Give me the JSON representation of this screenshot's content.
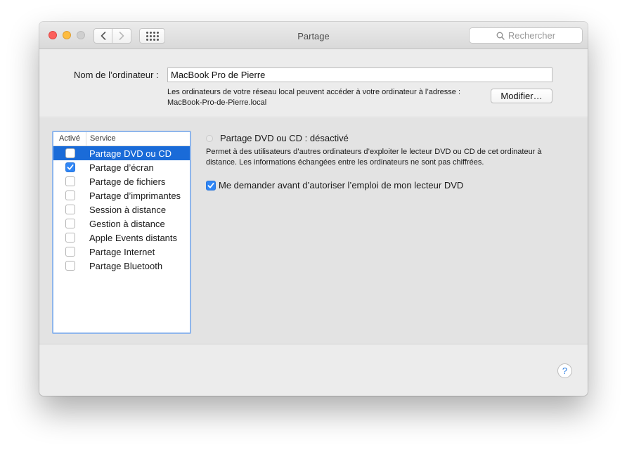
{
  "window": {
    "title": "Partage",
    "search_placeholder": "Rechercher"
  },
  "computer_name": {
    "label": "Nom de l’ordinateur :",
    "value": "MacBook Pro de Pierre",
    "note_line1": "Les ordinateurs de votre réseau local peuvent accéder à votre ordinateur à l’adresse :",
    "note_line2": "MacBook-Pro-de-Pierre.local",
    "modify_button": "Modifier…"
  },
  "services": {
    "header_active": "Activé",
    "header_service": "Service",
    "items": [
      {
        "label": "Partage DVD ou CD",
        "checked": false,
        "selected": true
      },
      {
        "label": "Partage d’écran",
        "checked": true,
        "selected": false
      },
      {
        "label": "Partage de fichiers",
        "checked": false,
        "selected": false
      },
      {
        "label": "Partage d’imprimantes",
        "checked": false,
        "selected": false
      },
      {
        "label": "Session à distance",
        "checked": false,
        "selected": false
      },
      {
        "label": "Gestion à distance",
        "checked": false,
        "selected": false
      },
      {
        "label": "Apple Events distants",
        "checked": false,
        "selected": false
      },
      {
        "label": "Partage Internet",
        "checked": false,
        "selected": false
      },
      {
        "label": "Partage Bluetooth",
        "checked": false,
        "selected": false
      }
    ]
  },
  "detail": {
    "status_title": "Partage DVD ou CD : désactivé",
    "description_line1": "Permet à des utilisateurs d’autres ordinateurs d’exploiter le lecteur DVD ou CD de cet ordinateur à",
    "description_line2": "distance. Les informations échangées entre les ordinateurs ne sont pas chiffrées.",
    "ask_label": "Me demander avant d’autoriser l’emploi de mon lecteur DVD",
    "ask_checked": true
  },
  "help_label": "?",
  "colors": {
    "selection": "#1a6bd8",
    "checkbox_checked": "#2f86f6",
    "close": "#fc605c",
    "minimize": "#fdbc40",
    "zoom": "#cfcfcf"
  }
}
